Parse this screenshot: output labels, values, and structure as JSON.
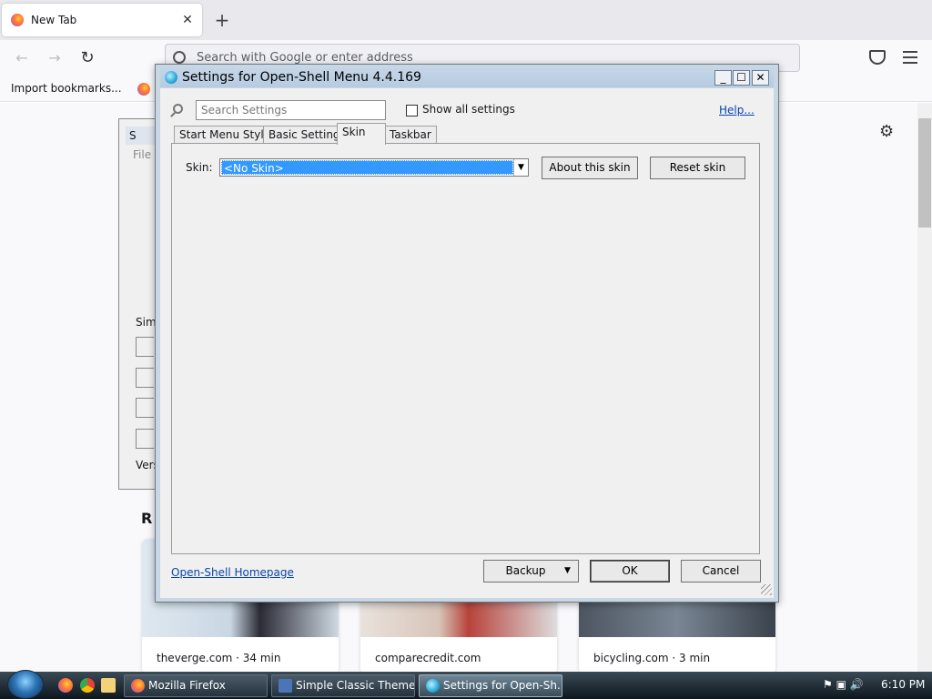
{
  "browser": {
    "tab_title": "New Tab",
    "tab_close": "✕",
    "new_tab": "+",
    "back": "←",
    "forward": "→",
    "reload": "↻",
    "url_placeholder": "Search with Google or enter address",
    "bookmark_import": "Import bookmarks...",
    "settings_gear": "⚙",
    "recent_heading": "R",
    "cards": [
      {
        "label": "theverge.com · 34 min"
      },
      {
        "label": "comparecredit.com"
      },
      {
        "label": "bicycling.com · 3 min"
      }
    ]
  },
  "background_window": {
    "title": "S",
    "menu_file": "File",
    "label_simple": "Simp",
    "label_version": "Vers"
  },
  "dialog": {
    "title": "Settings for Open-Shell Menu 4.4.169",
    "minimize": "_",
    "maximize": "☐",
    "close": "✕",
    "search_placeholder": "Search Settings",
    "show_all_label": "Show all settings",
    "help_link": "Help...",
    "tabs": [
      {
        "label": "Start Menu Style"
      },
      {
        "label": "Basic Settings"
      },
      {
        "label": "Skin"
      },
      {
        "label": "Taskbar"
      }
    ],
    "active_tab": "Skin",
    "skin_label": "Skin:",
    "skin_value": "<No Skin>",
    "about_skin": "About this skin",
    "reset_skin": "Reset skin",
    "homepage_link": "Open-Shell Homepage",
    "backup": "Backup",
    "ok": "OK",
    "cancel": "Cancel"
  },
  "taskbar": {
    "items": [
      {
        "label": "Mozilla Firefox"
      },
      {
        "label": "Simple Classic Theme"
      },
      {
        "label": "Settings for Open-Sh..."
      }
    ],
    "clock": "6:10 PM"
  },
  "colors": {
    "selection": "#3399ff",
    "link": "#0645ad",
    "titlebar": "#b7cbe0"
  }
}
